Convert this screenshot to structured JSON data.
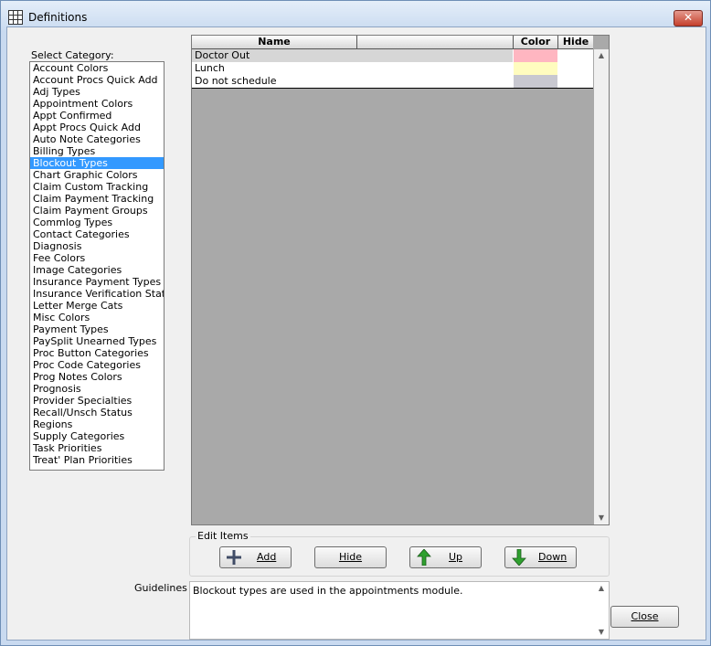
{
  "window": {
    "title": "Definitions"
  },
  "category_label": "Select Category:",
  "categories": [
    "Account Colors",
    "Account Procs Quick Add",
    "Adj Types",
    "Appointment Colors",
    "Appt Confirmed",
    "Appt Procs Quick Add",
    "Auto Note Categories",
    "Billing Types",
    "Blockout Types",
    "Chart Graphic Colors",
    "Claim Custom Tracking",
    "Claim Payment Tracking",
    "Claim Payment Groups",
    "Commlog Types",
    "Contact Categories",
    "Diagnosis",
    "Fee Colors",
    "Image Categories",
    "Insurance Payment Types",
    "Insurance Verification Status",
    "Letter Merge Cats",
    "Misc Colors",
    "Payment Types",
    "PaySplit Unearned Types",
    "Proc Button Categories",
    "Proc Code Categories",
    "Prog Notes Colors",
    "Prognosis",
    "Provider Specialties",
    "Recall/Unsch Status",
    "Regions",
    "Supply Categories",
    "Task Priorities",
    "Treat' Plan Priorities"
  ],
  "selected_category": "Blockout Types",
  "grid": {
    "columns": {
      "name": "Name",
      "color": "Color",
      "hide": "Hide"
    },
    "rows": [
      {
        "name": "Doctor Out",
        "color": "#ffb6c1",
        "selected": true
      },
      {
        "name": "Lunch",
        "color": "#fffcbf",
        "selected": false
      },
      {
        "name": "Do not schedule",
        "color": "#c8c8d0",
        "selected": false
      }
    ]
  },
  "edit_items": {
    "title": "Edit Items",
    "add": "Add",
    "hide": "Hide",
    "up": "Up",
    "down": "Down"
  },
  "guidelines": {
    "label": "Guidelines",
    "text": "Blockout types are used in the appointments module."
  },
  "close_button": "Close"
}
